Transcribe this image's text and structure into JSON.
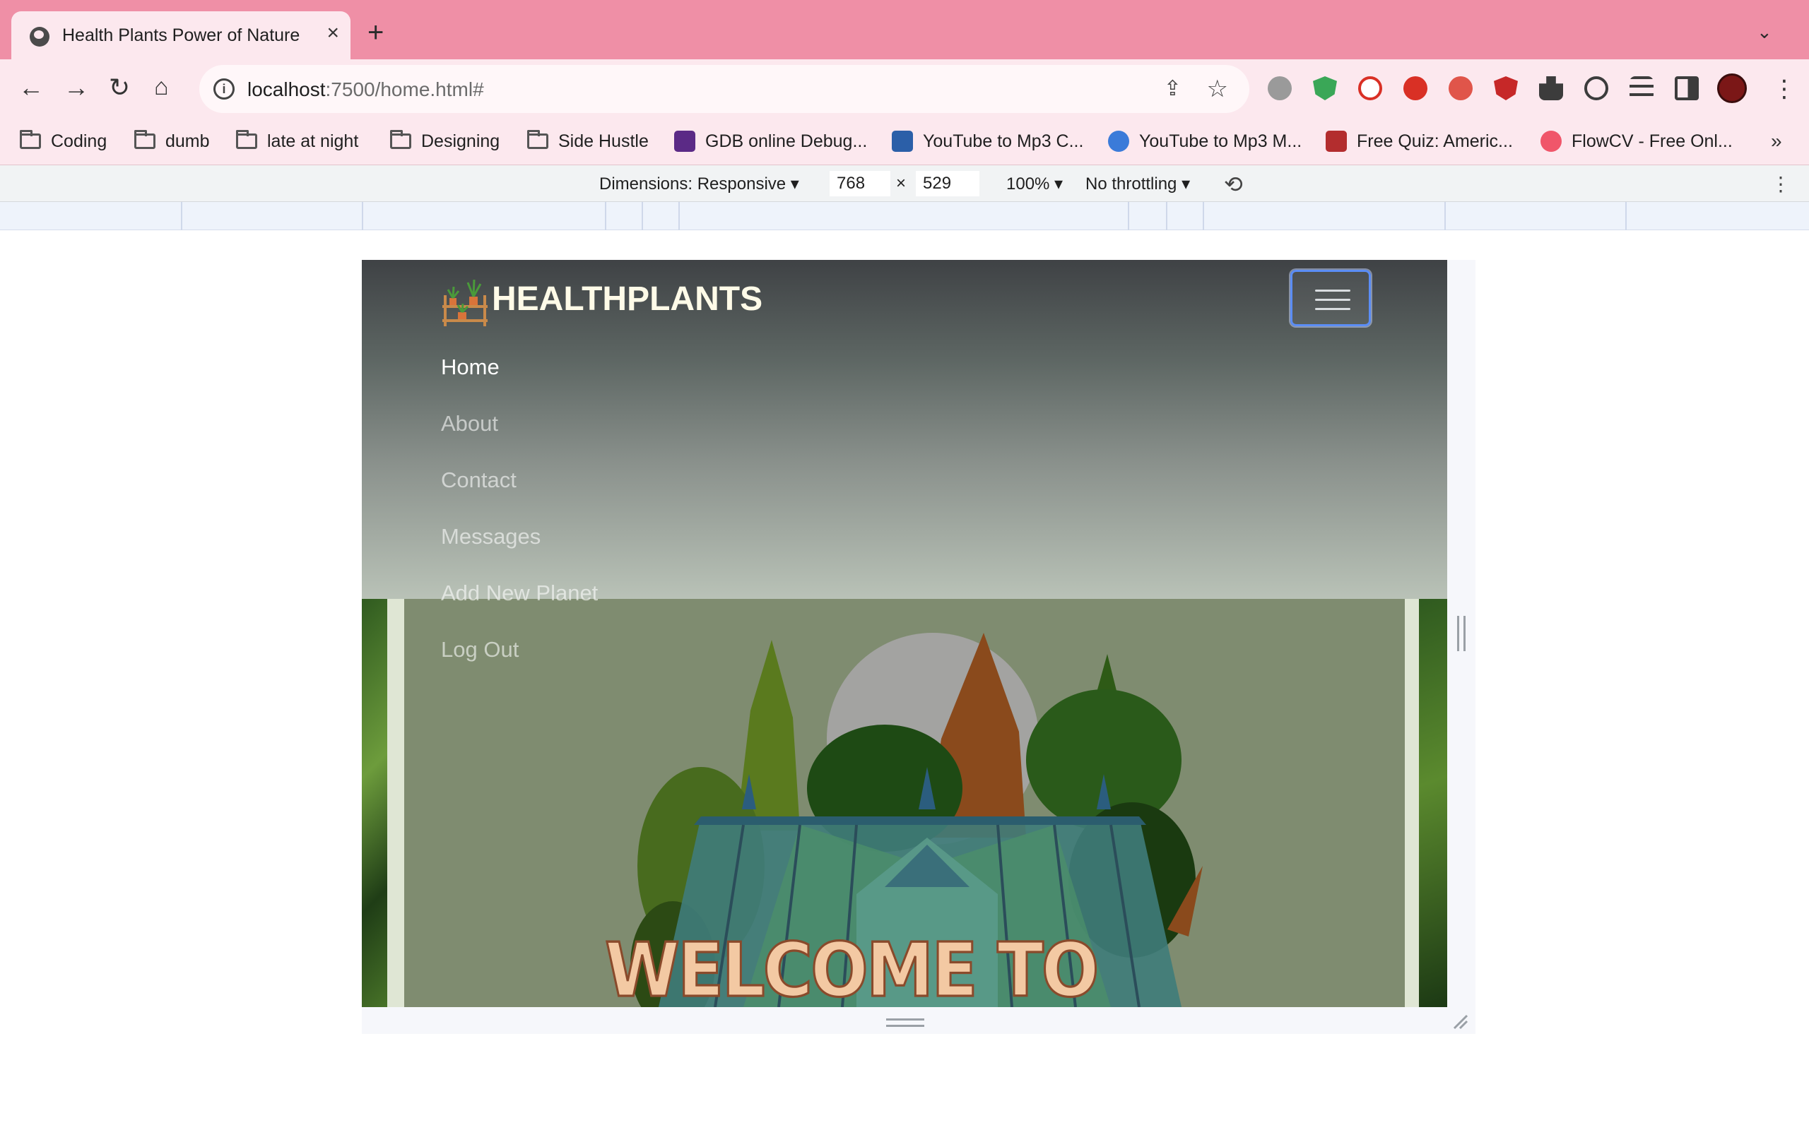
{
  "browser": {
    "tab_title": "Health Plants Power of Nature",
    "tab_close": "×",
    "new_tab": "+",
    "url_host": "localhost",
    "url_path": ":7500/home.html#"
  },
  "bookmarks": [
    {
      "label": "Coding",
      "icon": "folder-icon"
    },
    {
      "label": "dumb",
      "icon": "folder-icon"
    },
    {
      "label": "late at night",
      "icon": "folder-icon"
    },
    {
      "label": "Designing",
      "icon": "folder-icon"
    },
    {
      "label": "Side Hustle",
      "icon": "folder-icon"
    },
    {
      "label": "GDB online Debug...",
      "icon": "gdb-favicon",
      "color": "#5b2a86"
    },
    {
      "label": "YouTube to Mp3 C...",
      "icon": "download-favicon",
      "color": "#2b5fa8"
    },
    {
      "label": "YouTube to Mp3 M...",
      "icon": "cloud-download-favicon",
      "color": "#3b7bd9"
    },
    {
      "label": "Free Quiz: Americ...",
      "icon": "tyl-favicon",
      "color": "#b32d2e"
    },
    {
      "label": "FlowCV - Free Onl...",
      "icon": "flowcv-favicon",
      "color": "#f0566a"
    }
  ],
  "devtools": {
    "dimensions_label": "Dimensions: Responsive",
    "width": "768",
    "times": "×",
    "height": "529",
    "zoom": "100%",
    "throttling": "No throttling"
  },
  "site": {
    "brand": "HEALTHPLANTS",
    "nav_items": [
      {
        "label": "Home",
        "active": true
      },
      {
        "label": "About",
        "active": false
      },
      {
        "label": "Contact",
        "active": false
      },
      {
        "label": "Messages",
        "active": false
      },
      {
        "label": "Add New Planet",
        "active": false
      },
      {
        "label": "Log Out",
        "active": false
      }
    ],
    "hero_heading": "WELCOME TO"
  },
  "colors": {
    "tabstrip": "#ef8fa6",
    "toolbar": "#fce8ee",
    "toggler_focus": "#5b8df6",
    "welcome_fill": "#f3c9a3",
    "welcome_stroke": "#8a4a2b"
  }
}
